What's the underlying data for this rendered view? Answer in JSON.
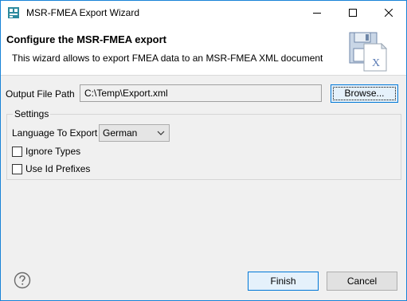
{
  "window": {
    "title": "MSR-FMEA Export Wizard"
  },
  "banner": {
    "title": "Configure the MSR-FMEA export",
    "description": "This wizard allows to export FMEA data to an MSR-FMEA XML document"
  },
  "output": {
    "label": "Output File Path",
    "value": "C:\\Temp\\Export.xml",
    "browse_label": "Browse..."
  },
  "settings": {
    "group_label": "Settings",
    "language_label": "Language To Export",
    "language_value": "German",
    "ignore_types_label": "Ignore Types",
    "ignore_types_checked": false,
    "use_id_prefixes_label": "Use Id Prefixes",
    "use_id_prefixes_checked": false
  },
  "footer": {
    "finish_label": "Finish",
    "cancel_label": "Cancel"
  },
  "colors": {
    "accent": "#0078d7",
    "window_border": "#1883d7",
    "background": "#f0f0f0"
  },
  "icons": [
    "app-icon",
    "minimize-icon",
    "maximize-icon",
    "close-icon",
    "export-wizard-icon",
    "help-icon",
    "chevron-down-icon"
  ]
}
